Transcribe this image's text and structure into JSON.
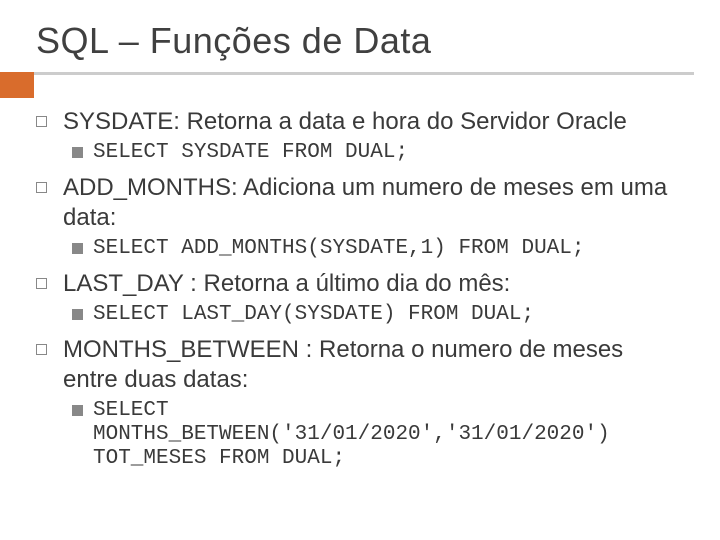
{
  "title": "SQL – Funções de Data",
  "items": [
    {
      "text": "SYSDATE: Retorna a data e hora do Servidor Oracle",
      "sub": [
        {
          "code": "SELECT SYSDATE FROM DUAL;"
        }
      ]
    },
    {
      "text": "ADD_MONTHS: Adiciona um numero de meses em uma data:",
      "sub": [
        {
          "code": "SELECT ADD_MONTHS(SYSDATE,1) FROM DUAL;"
        }
      ]
    },
    {
      "text": "LAST_DAY : Retorna a último dia do mês:",
      "sub": [
        {
          "code": "SELECT LAST_DAY(SYSDATE) FROM DUAL;"
        }
      ]
    },
    {
      "text": "MONTHS_BETWEEN : Retorna o numero de meses entre duas datas:",
      "sub": [
        {
          "code": "SELECT MONTHS_BETWEEN('31/01/2020','31/01/2020') TOT_MESES FROM DUAL;"
        }
      ]
    }
  ]
}
